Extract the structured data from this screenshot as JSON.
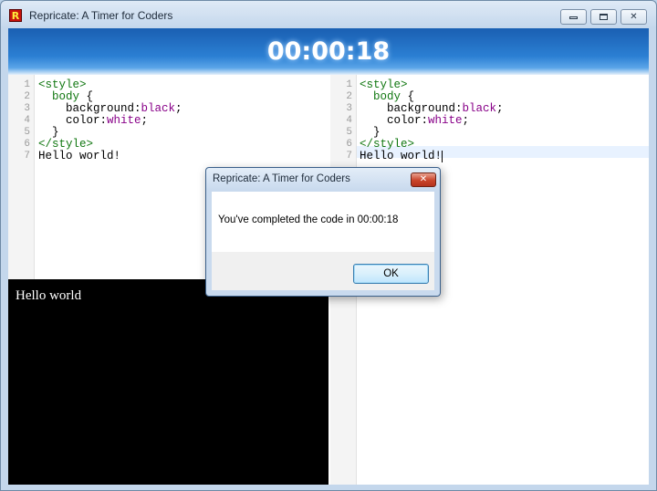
{
  "window": {
    "title": "Repricate: A Timer for Coders",
    "icon_letter": "R"
  },
  "timer": {
    "value": "00:00:18"
  },
  "left_editor": {
    "line_numbers": [
      "1",
      "2",
      "3",
      "4",
      "5",
      "6",
      "7"
    ]
  },
  "right_editor": {
    "line_numbers": [
      "1",
      "2",
      "3",
      "4",
      "5",
      "6",
      "7"
    ]
  },
  "code": {
    "l1": "<style>",
    "l2_tag": "  body",
    "l2_brace": " {",
    "l3_prop": "    background:",
    "l3_val": "black",
    "l3_end": ";",
    "l4_prop": "    color:",
    "l4_val": "white",
    "l4_end": ";",
    "l5": "  }",
    "l6": "</style>",
    "l7": "Hello world!"
  },
  "preview": {
    "text": "Hello world"
  },
  "dialog": {
    "title": "Repricate: A Timer for Coders",
    "message": "You've completed the code in 00:00:18",
    "ok_label": "OK",
    "close_glyph": "✕"
  },
  "colors": {
    "tag": "#117711",
    "value": "#880088",
    "timer_bar": "#2b7fd3"
  }
}
